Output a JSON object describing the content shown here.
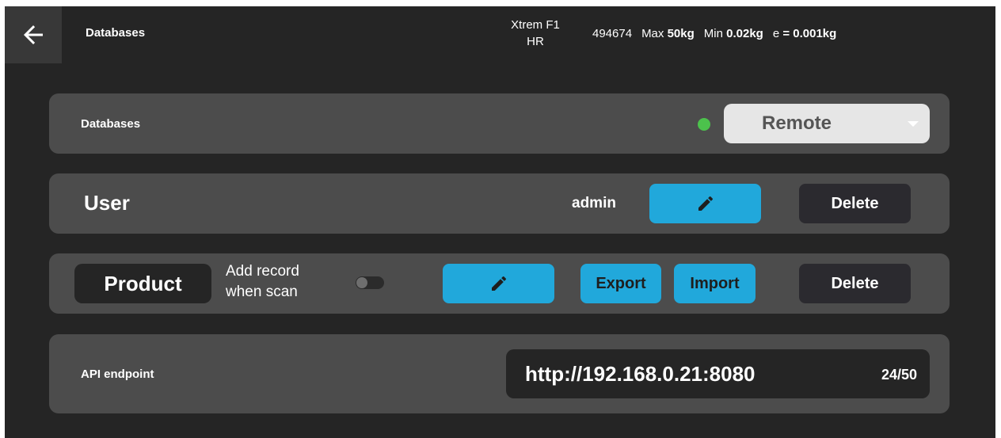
{
  "header": {
    "title": "Databases",
    "device_line1": "Xtrem F1",
    "device_line2": "HR",
    "serial": "494674",
    "max_label": "Max",
    "max_value": "50kg",
    "min_label": "Min",
    "min_value": "0.02kg",
    "e_label": "e",
    "e_value": "= 0.001kg"
  },
  "databases_card": {
    "label": "Databases",
    "status_color": "#4cc24c",
    "selected_option": "Remote"
  },
  "user_card": {
    "label": "User",
    "username": "admin",
    "edit_icon": "pencil-icon",
    "delete_label": "Delete"
  },
  "product_card": {
    "label": "Product",
    "add_record_line1": "Add record",
    "add_record_line2": "when scan",
    "toggle_on": false,
    "edit_icon": "pencil-icon",
    "export_label": "Export",
    "import_label": "Import",
    "delete_label": "Delete"
  },
  "api_card": {
    "label": "API endpoint",
    "value": "http://192.168.0.21:8080",
    "counter": "24/50"
  },
  "colors": {
    "background": "#252525",
    "card": "#4c4c4c",
    "accent_blue": "#21a8db",
    "dark_button": "#2b2a2f"
  }
}
